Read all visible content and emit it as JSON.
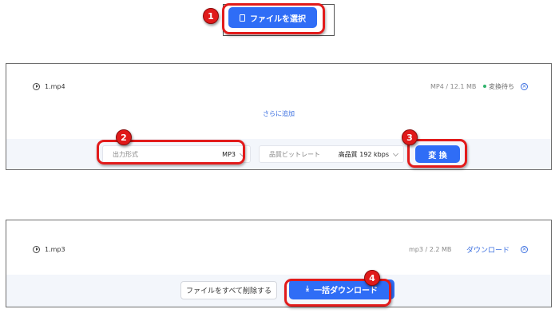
{
  "top": {
    "select_file_label": "ファイルを選択",
    "badge": "1"
  },
  "panel1": {
    "file": {
      "name": "1.mp4",
      "meta": "MP4 / 12.1 MB",
      "status": "変換待ち"
    },
    "add_more": "さらに追加",
    "output_format": {
      "label": "出力形式",
      "value": "MP3",
      "badge": "2"
    },
    "quality": {
      "label": "品質ビットレート",
      "value": "高品質 192 kbps"
    },
    "convert": {
      "label": "変 換",
      "badge": "3"
    }
  },
  "panel2": {
    "file": {
      "name": "1.mp3",
      "meta": "mp3 / 2.2 MB",
      "download_label": "ダウンロード"
    },
    "clear_all_label": "ファイルをすべて削除する",
    "bulk_download": {
      "label": "一括ダウンロード",
      "badge": "4"
    }
  },
  "colors": {
    "primary": "#2f6df6",
    "highlight": "#e21b1b",
    "link": "#3b6fe0",
    "status_dot": "#2fb36b"
  }
}
